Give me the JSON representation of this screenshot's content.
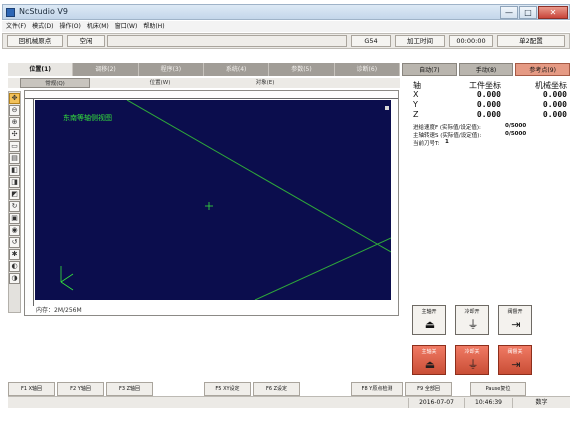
{
  "window": {
    "title": "NcStudio V9"
  },
  "window_controls": {
    "minimize": "—",
    "maximize": "□",
    "close": "✕"
  },
  "menu": [
    "文件(F)",
    "模式(D)",
    "操作(O)",
    "机床(M)",
    "窗口(W)",
    "帮助(H)"
  ],
  "top_status": {
    "home_button": "回机械原点",
    "state": "空闲",
    "code": "G54",
    "process_time_label": "加工时间",
    "process_time": "00:00:00",
    "single_config": "单2配置"
  },
  "left_tabs": [
    "位置(1)",
    "调移(2)",
    "程序(3)",
    "系统(4)",
    "参数(5)",
    "诊断(6)"
  ],
  "left_subtabs": [
    "常规(Q)",
    "位置(W)",
    "对象(E)"
  ],
  "canvas": {
    "title": "东南等轴侧视图",
    "memory": "内存：2M/256M"
  },
  "right_tabs": [
    "自动(7)",
    "手动(8)",
    "参考点(9)"
  ],
  "coords": {
    "headers": {
      "axis": "轴",
      "work": "工件坐标",
      "machine": "机械坐标"
    },
    "rows": [
      {
        "axis": "X",
        "work": "0.000",
        "machine": "0.000"
      },
      {
        "axis": "Y",
        "work": "0.000",
        "machine": "0.000"
      },
      {
        "axis": "Z",
        "work": "0.000",
        "machine": "0.000"
      }
    ]
  },
  "info": [
    {
      "key": "进给速度F (实际值/设定值):",
      "value": "0/5000"
    },
    {
      "key": "主轴转速S (实际值/设定值):",
      "value": "0/5000"
    },
    {
      "key": "当前刀号T:",
      "value": "1"
    }
  ],
  "controls": {
    "spindle_on": "主轴开",
    "coolant_on": "冷却开",
    "valve_on": "阀督开",
    "spindle_off": "主轴关",
    "coolant_off": "冷却关",
    "valve_off": "阀督关"
  },
  "fkeys": {
    "f1": "F1 X轴回",
    "f2": "F2 Y轴回",
    "f3": "F3 Z轴回",
    "f5": "F5 XY设定",
    "f6": "F6 Z设定",
    "f8": "F8 Y原点检测",
    "f9": "F9 全部回",
    "pause": "Pause复位"
  },
  "bottom_status": {
    "date": "2016-07-07",
    "time": "10:46:39",
    "mode": "数字"
  },
  "colors": {
    "canvas_bg": "#0b0d4d",
    "path_green": "#35e23c",
    "active_tab": "#e59a84",
    "red_button": "#c94e36"
  }
}
